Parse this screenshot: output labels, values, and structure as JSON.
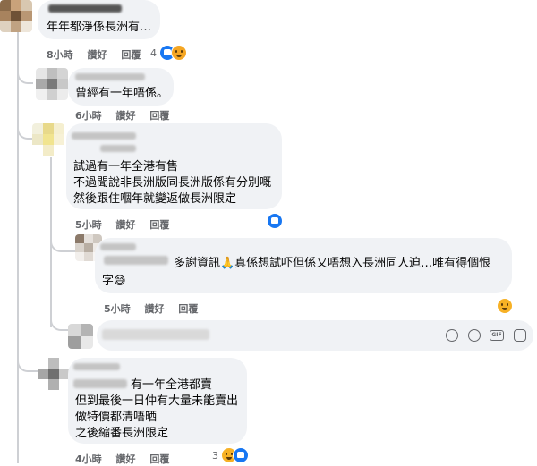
{
  "comments": [
    {
      "text_lines": [
        "年年都淨係長洲有…"
      ],
      "time": "8小時",
      "like_label": "讚好",
      "reply_label": "回覆",
      "reaction_count": "4",
      "reactions": [
        "like-icon",
        "sad-emoji-icon"
      ]
    },
    {
      "text_lines": [
        "曾經有一年唔係。"
      ],
      "time": "6小時",
      "like_label": "讚好",
      "reply_label": "回覆"
    },
    {
      "text_lines": [
        "試過有一年全港有售",
        "不過聞說非長洲版同長洲版係有分別嘅",
        "然後跟住嗰年就變返做長洲限定"
      ],
      "time": "5小時",
      "like_label": "讚好",
      "reply_label": "回覆",
      "reactions": [
        "like-icon"
      ]
    },
    {
      "text_lines": [
        "多謝資訊🙏真係想試吓但係又唔想入長洲同人迫…唯有得個恨",
        "字😅"
      ],
      "time": "5小時",
      "like_label": "讚好",
      "reply_label": "回覆",
      "reactions": [
        "laugh-emoji-icon"
      ]
    },
    {
      "text_lines": [
        "有一年全港都賣",
        "但到最後一日仲有大量未能賣出",
        "做特價都清唔晒",
        "之後縮番長洲限定"
      ],
      "time": "4小時",
      "like_label": "讚好",
      "reply_label": "回覆",
      "reaction_count": "3",
      "reactions": [
        "wow-emoji-icon",
        "like-icon"
      ]
    }
  ],
  "reply_input": {
    "icons": [
      "avatar-sticker-icon",
      "emoji-icon",
      "gif-icon",
      "sticker-icon"
    ]
  },
  "colors": {
    "bubble": "#f0f2f5",
    "meta": "#65676b",
    "like": "#1877f2",
    "emoji": "#f7b125",
    "thread_line": "#ced0d4"
  }
}
